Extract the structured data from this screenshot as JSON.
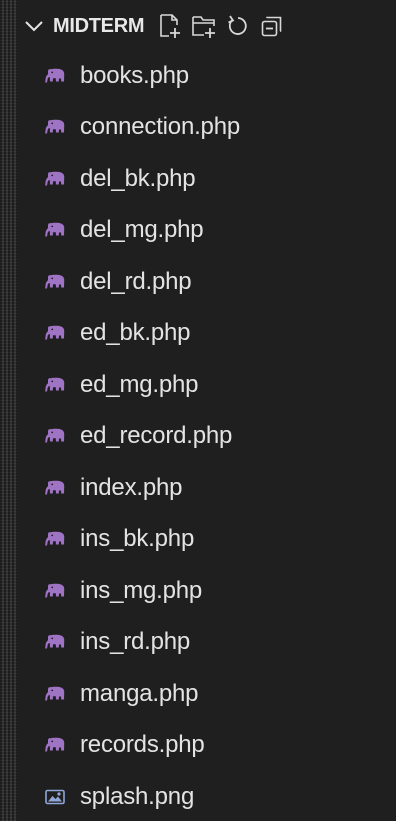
{
  "explorer": {
    "section_title": "MIDTERM",
    "files": [
      {
        "name": "books.php",
        "icon": "php-elephant-icon"
      },
      {
        "name": "connection.php",
        "icon": "php-elephant-icon"
      },
      {
        "name": "del_bk.php",
        "icon": "php-elephant-icon"
      },
      {
        "name": "del_mg.php",
        "icon": "php-elephant-icon"
      },
      {
        "name": "del_rd.php",
        "icon": "php-elephant-icon"
      },
      {
        "name": "ed_bk.php",
        "icon": "php-elephant-icon"
      },
      {
        "name": "ed_mg.php",
        "icon": "php-elephant-icon"
      },
      {
        "name": "ed_record.php",
        "icon": "php-elephant-icon"
      },
      {
        "name": "index.php",
        "icon": "php-elephant-icon"
      },
      {
        "name": "ins_bk.php",
        "icon": "php-elephant-icon"
      },
      {
        "name": "ins_mg.php",
        "icon": "php-elephant-icon"
      },
      {
        "name": "ins_rd.php",
        "icon": "php-elephant-icon"
      },
      {
        "name": "manga.php",
        "icon": "php-elephant-icon"
      },
      {
        "name": "records.php",
        "icon": "php-elephant-icon"
      },
      {
        "name": "splash.png",
        "icon": "image-file-icon"
      }
    ]
  },
  "colors": {
    "background": "#1f1f1f",
    "text": "#e3e3e3",
    "php_icon": "#a074c4",
    "image_icon": "#8fa7d6"
  }
}
